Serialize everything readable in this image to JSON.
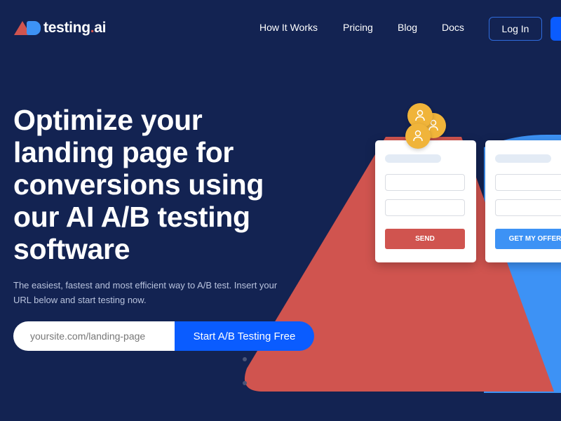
{
  "brand": {
    "name_main": "testing",
    "name_dot": ".",
    "name_tail": "ai"
  },
  "nav": {
    "items": [
      {
        "label": "How It Works"
      },
      {
        "label": "Pricing"
      },
      {
        "label": "Blog"
      },
      {
        "label": "Docs"
      }
    ],
    "login_label": "Log In"
  },
  "hero": {
    "title": "Optimize your landing page for conversions using our AI A/B testing software",
    "subtitle": "The easiest, fastest and most efficient way to A/B test. Insert your URL below and start testing now.",
    "url_placeholder": "yoursite.com/landing-page",
    "cta_label": "Start A/B Testing Free"
  },
  "illustration": {
    "variant_a_button": "SEND",
    "variant_b_button": "GET MY OFFER",
    "user_icons": [
      "user-icon",
      "user-icon",
      "user-icon"
    ]
  },
  "colors": {
    "background": "#132352",
    "accent_red": "#d0544f",
    "accent_blue": "#3d92f5",
    "cta_blue": "#0a5cff",
    "avatar_yellow": "#f0b43a"
  }
}
